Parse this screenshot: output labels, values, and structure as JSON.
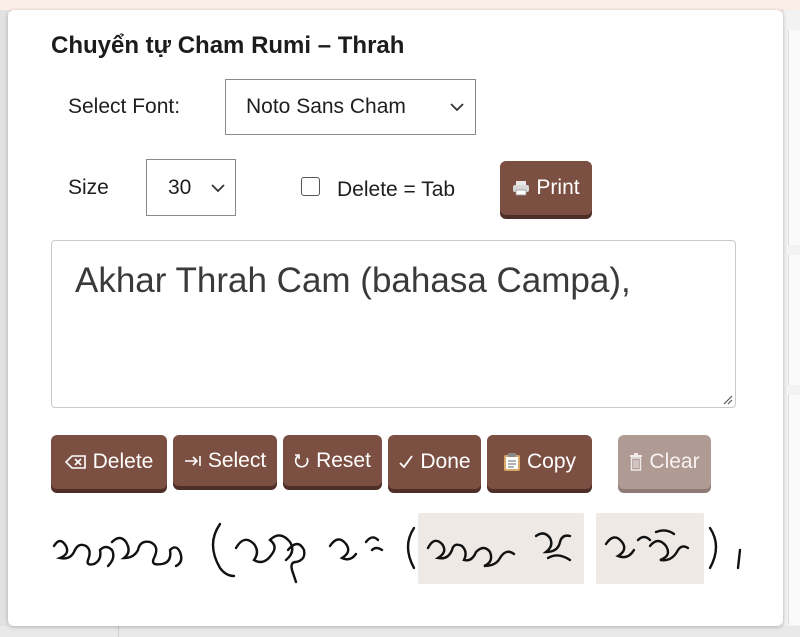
{
  "title": "Chuyển tự Cham Rumi – Thrah",
  "font_select": {
    "label": "Select Font:",
    "value": "Noto Sans Cham"
  },
  "size_select": {
    "label": "Size",
    "value": "30"
  },
  "delete_tab": {
    "label": "Delete = Tab",
    "checked": false
  },
  "buttons": {
    "print": "Print",
    "delete": "Delete",
    "select": "Select",
    "reset": "Reset",
    "done": "Done",
    "copy": "Copy",
    "clear": "Clear"
  },
  "input_text": "Akhar Thrah Cam (bahasa Campa),",
  "colors": {
    "button": "#7b4f42",
    "button_disabled": "#b09a94",
    "highlight": "#efe9e6"
  },
  "icons": {
    "print": "printer-icon",
    "delete": "backspace-icon",
    "select": "tab-arrow-icon",
    "reset": "reset-arrow-icon",
    "done": "checkmark-icon",
    "copy": "clipboard-icon",
    "clear": "trash-icon"
  }
}
